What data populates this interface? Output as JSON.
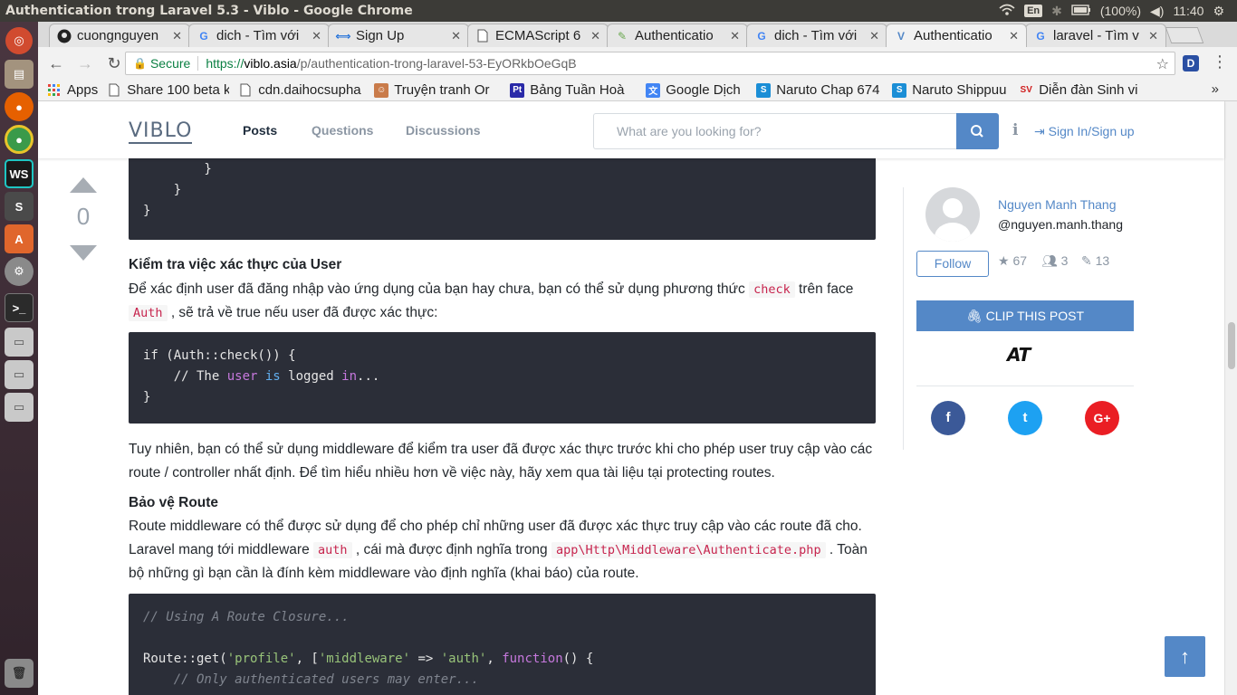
{
  "os": {
    "window_title": "Authentication trong Laravel 5.3 - Viblo - Google Chrome",
    "lang": "En",
    "battery": "(100%)",
    "clock": "11:40"
  },
  "tabs": [
    {
      "label": "cuongnguyen",
      "favicon": "github-icon",
      "active": false
    },
    {
      "label": "dich - Tìm với",
      "favicon": "google-icon",
      "active": false
    },
    {
      "label": "Sign Up",
      "favicon": "arrows-icon",
      "active": false
    },
    {
      "label": "ECMAScript 6",
      "favicon": "document-icon",
      "active": false
    },
    {
      "label": "Authenticatio",
      "favicon": "pen-icon",
      "active": false
    },
    {
      "label": "dich - Tìm với",
      "favicon": "google-icon",
      "active": false
    },
    {
      "label": "Authenticatio",
      "favicon": "viblo-icon",
      "active": true
    },
    {
      "label": "laravel - Tìm v",
      "favicon": "google-icon",
      "active": false
    }
  ],
  "profile_label": "do",
  "toolbar": {
    "secure_label": "Secure",
    "url_scheme": "https://",
    "url_host": "viblo.asia",
    "url_path": "/p/authentication-trong-laravel-53-EyORkbOeGqB"
  },
  "bookmarks": [
    {
      "label": "Apps",
      "icon": "apps-grid-icon"
    },
    {
      "label": "Share 100 beta k",
      "icon": "page-icon"
    },
    {
      "label": "cdn.daihocsupha",
      "icon": "page-icon"
    },
    {
      "label": "Truyện tranh Or",
      "icon": "manga-icon"
    },
    {
      "label": "Bảng Tuần Hoà",
      "icon": "pt-icon"
    },
    {
      "label": "Google Dịch",
      "icon": "translate-icon"
    },
    {
      "label": "Naruto Chap 674",
      "icon": "s-icon"
    },
    {
      "label": "Naruto Shippuu",
      "icon": "s-icon"
    },
    {
      "label": "Diễn đàn Sinh vi",
      "icon": "forum-icon"
    }
  ],
  "site": {
    "logo": "VIBLO",
    "nav": [
      "Posts",
      "Questions",
      "Discussions"
    ],
    "search_placeholder": "What are you looking for?",
    "signin": "Sign In/Sign up"
  },
  "vote": {
    "count": "0"
  },
  "article": {
    "code1": [
      "        }",
      "    }",
      "}"
    ],
    "heading1": "Kiểm tra việc xác thực của User",
    "para1_a": "Để xác định user đã đăng nhập vào ứng dụng của bạn hay chưa, bạn có thể sử dụng phương thức ",
    "para1_code1": "check",
    "para1_b": " trên face",
    "para1_code2": "Auth",
    "para1_c": " , sẽ trả về true nếu user đã được xác thực:",
    "code2_l1": "if (Auth::check()) {",
    "code2_l2_a": "    // The ",
    "code2_l2_user": "user",
    "code2_l2_is": "is",
    "code2_l2_b": " logged ",
    "code2_l2_in": "in",
    "code2_l2_c": "...",
    "code2_l3": "}",
    "para2": "Tuy nhiên, bạn có thể sử dụng middleware để kiểm tra user đã được xác thực trước khi cho phép user truy cập vào các route / controller nhất định. Để tìm hiểu nhiều hơn về việc này, hãy xem qua tài liệu tại protecting routes.",
    "heading2": "Bảo vệ Route",
    "para3_a": "Route middleware có thể được sử dụng để cho phép chỉ những user đã được xác thực truy cập vào các route đã cho. Laravel mang tới middleware ",
    "para3_code1": "auth",
    "para3_b": " , cái mà được định nghĩa trong ",
    "para3_code2": "app\\Http\\Middleware\\Authenticate.php",
    "para3_c": " . Toàn bộ những gì bạn cần là đính kèm middleware vào định nghĩa (khai báo) của route.",
    "code3_comment1": "// Using A Route Closure...",
    "code3_l2_a": "Route::get(",
    "code3_l2_s1": "'profile'",
    "code3_l2_b": ", [",
    "code3_l2_s2": "'middleware'",
    "code3_l2_c": " => ",
    "code3_l2_s3": "'auth'",
    "code3_l2_d": ", ",
    "code3_l2_fn": "function",
    "code3_l2_e": "() {",
    "code3_comment2": "    // Only authenticated users may enter..."
  },
  "sidebar": {
    "author_name": "Nguyen Manh Thang",
    "author_handle": "@nguyen.manh.thang",
    "follow_label": "Follow",
    "stat_reputation": "67",
    "stat_followers": "3",
    "stat_posts": "13",
    "clip_label": "CLIP THIS POST",
    "brand_mark": "AT",
    "share": [
      "f",
      "t",
      "G+"
    ]
  },
  "colors": {
    "accent": "#5488c7",
    "code_bg": "#2b2e38",
    "facebook": "#3b5998",
    "twitter": "#1da1f2",
    "googleplus": "#ea1e24"
  }
}
